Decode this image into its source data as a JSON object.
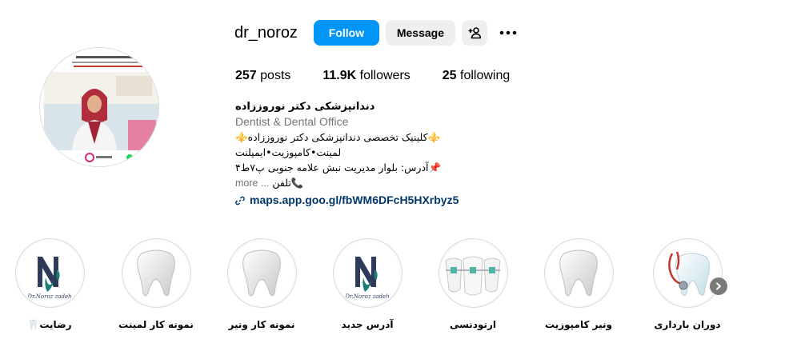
{
  "profile": {
    "username": "dr_noroz",
    "follow_label": "Follow",
    "message_label": "Message",
    "stats": {
      "posts_count": "257",
      "posts_label": " posts",
      "followers_count": "11.9K",
      "followers_label": " followers",
      "following_count": "25",
      "following_label": " following"
    }
  },
  "bio": {
    "name": "دندانپزشکی دکتر نوروززاده",
    "category": "Dentist & Dental Office",
    "line1": "⚜️کلینیک تخصصی دندانپزشکی دکتر نوروززاده⚜️",
    "line2": "لمینت•کامپوزیت•ایمپلنت",
    "line3": "📌آدرس: بلوار مدیریت نبش علامه جنوبی پ۷ط۴",
    "line4": "📞تلفن",
    "more_label": "... more",
    "link": "maps.app.goo.gl/fbWM6DFcH5HXrbyz5"
  },
  "highlights": [
    {
      "label": "رضایت🦷",
      "icon": "dr-noroz-logo"
    },
    {
      "label": "نمونه کار لمینت",
      "icon": "tooth"
    },
    {
      "label": "نمونه کار ونیر",
      "icon": "tooth"
    },
    {
      "label": "آدرس جدید",
      "icon": "dr-noroz-logo"
    },
    {
      "label": "ارتودنسی",
      "icon": "braces-teeth"
    },
    {
      "label": "ونیر کامپوزیت",
      "icon": "tooth"
    },
    {
      "label": "دوران بارداری",
      "icon": "tooth-stethoscope"
    }
  ],
  "logo_text": "Dr.Noroz zadeh",
  "colors": {
    "follow_blue": "#0095f6",
    "link_blue": "#00376b",
    "logo_teal": "#1a7f73",
    "logo_navy": "#2d3a5a"
  }
}
